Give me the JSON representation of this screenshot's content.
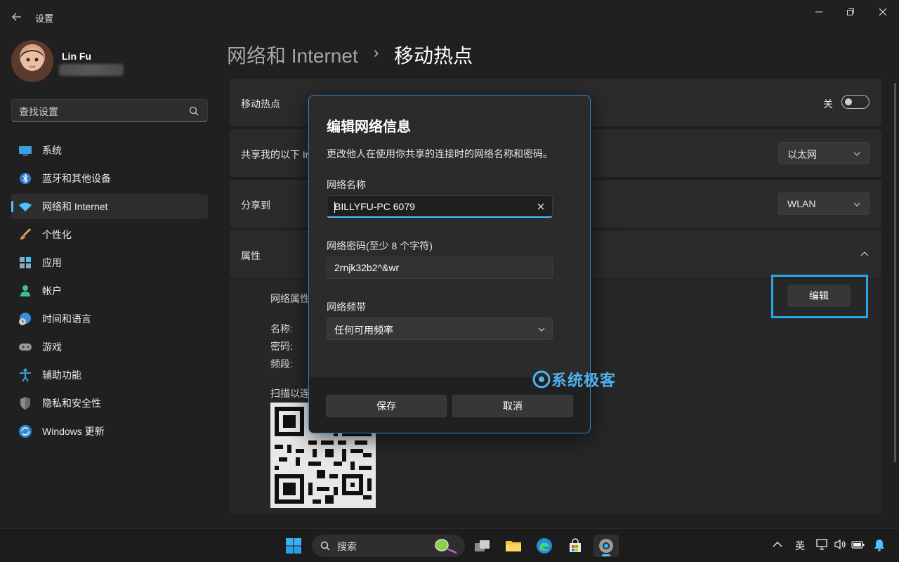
{
  "window": {
    "title": "设置"
  },
  "user": {
    "name": "Lin Fu"
  },
  "search": {
    "placeholder": "查找设置"
  },
  "nav": {
    "items": [
      {
        "label": "系统"
      },
      {
        "label": "蓝牙和其他设备"
      },
      {
        "label": "网络和 Internet"
      },
      {
        "label": "个性化"
      },
      {
        "label": "应用"
      },
      {
        "label": "帐户"
      },
      {
        "label": "时间和语言"
      },
      {
        "label": "游戏"
      },
      {
        "label": "辅助功能"
      },
      {
        "label": "隐私和安全性"
      },
      {
        "label": "Windows 更新"
      }
    ],
    "active_index": 2
  },
  "breadcrumb": {
    "parent": "网络和 Internet",
    "separator": "›",
    "current": "移动热点"
  },
  "hotspot": {
    "label": "移动热点",
    "toggle_state": "关"
  },
  "share_from": {
    "label": "共享我的以下 In",
    "value": "以太网"
  },
  "share_over": {
    "label": "分享到",
    "value": "WLAN"
  },
  "properties": {
    "label": "属性",
    "network_props_label": "网络属性",
    "name_label": "名称:",
    "password_label": "密码:",
    "band_label": "频段:",
    "scan_label": "扫描以连",
    "edit_button": "编辑"
  },
  "dialog": {
    "title": "编辑网络信息",
    "description": "更改他人在使用你共享的连接时的网络名称和密码。",
    "name_label": "网络名称",
    "name_value": "BILLYFU-PC 6079",
    "password_label": "网络密码(至少 8 个字符)",
    "password_value": "2rnjk32b2^&wr",
    "band_label": "网络频带",
    "band_value": "任何可用频率",
    "save_button": "保存",
    "cancel_button": "取消"
  },
  "watermark": "系统极客",
  "taskbar": {
    "search_label": "搜索",
    "ime": "英"
  },
  "colors": {
    "accent": "#4cc2ff",
    "highlight_box": "#2aa6e8",
    "background": "#202020",
    "card": "#2b2b2b"
  }
}
